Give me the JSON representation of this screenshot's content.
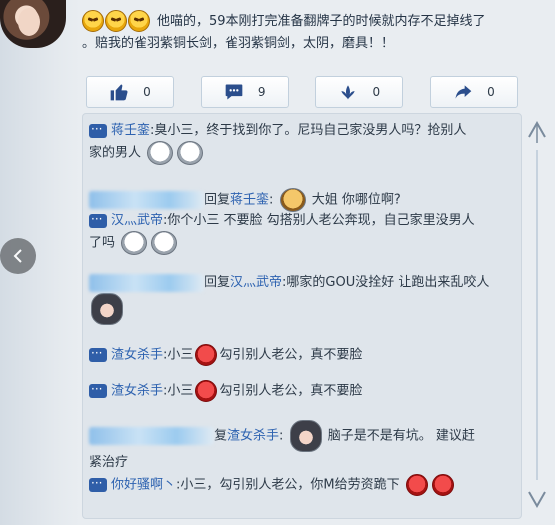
{
  "post": {
    "text_line1": "他喵的，59本刚打完准备翻牌子的时候就内存不足掉线了",
    "text_line2": "。赔我的雀羽紫铜长剑，雀羽紫铜剑，太阴，磨具！！"
  },
  "actions": [
    {
      "icon": "thumbs-up-icon",
      "count": "0"
    },
    {
      "icon": "comment-icon",
      "count": "9"
    },
    {
      "icon": "flower-icon",
      "count": "0"
    },
    {
      "icon": "share-icon",
      "count": "0"
    }
  ],
  "comments": [
    {
      "name": "蒋壬銮",
      "sep": ":",
      "text": "臭小三，终于找到你了。尼玛自己家没男人吗？抢别人",
      "text2": "家的男人"
    },
    {
      "reply_prefix": "回复",
      "name": "蒋壬銮",
      "sep": ":",
      "text": "大姐 你哪位啊?"
    },
    {
      "name": "汉灬武帝",
      "sep": ":",
      "text": "你个小三 不要脸 勾搭别人老公奔现，自己家里没男人",
      "text2": "了吗"
    },
    {
      "reply_prefix": "回复",
      "name": "汉灬武帝",
      "sep": ":",
      "text": "哪家的GOU没拴好 让跑出来乱咬人"
    },
    {
      "name": "渣女杀手",
      "sep": ":",
      "text_before": "小三",
      "text": "勾引别人老公，真不要脸"
    },
    {
      "name": "渣女杀手",
      "sep": ":",
      "text_before": "小三",
      "text": "勾引别人老公，真不要脸"
    },
    {
      "reply_prefix": "复",
      "name": "渣女杀手",
      "sep": ":",
      "text": "脑子是不是有坑。 建议赶",
      "text2": "紧治疗"
    },
    {
      "name": "你好骚啊丶",
      "sep": ":",
      "text": "小三，勾引别人老公，你M给劳资跪下"
    }
  ],
  "colors": {
    "accent": "#2d62b0",
    "icon_blue": "#2f5ea8"
  }
}
